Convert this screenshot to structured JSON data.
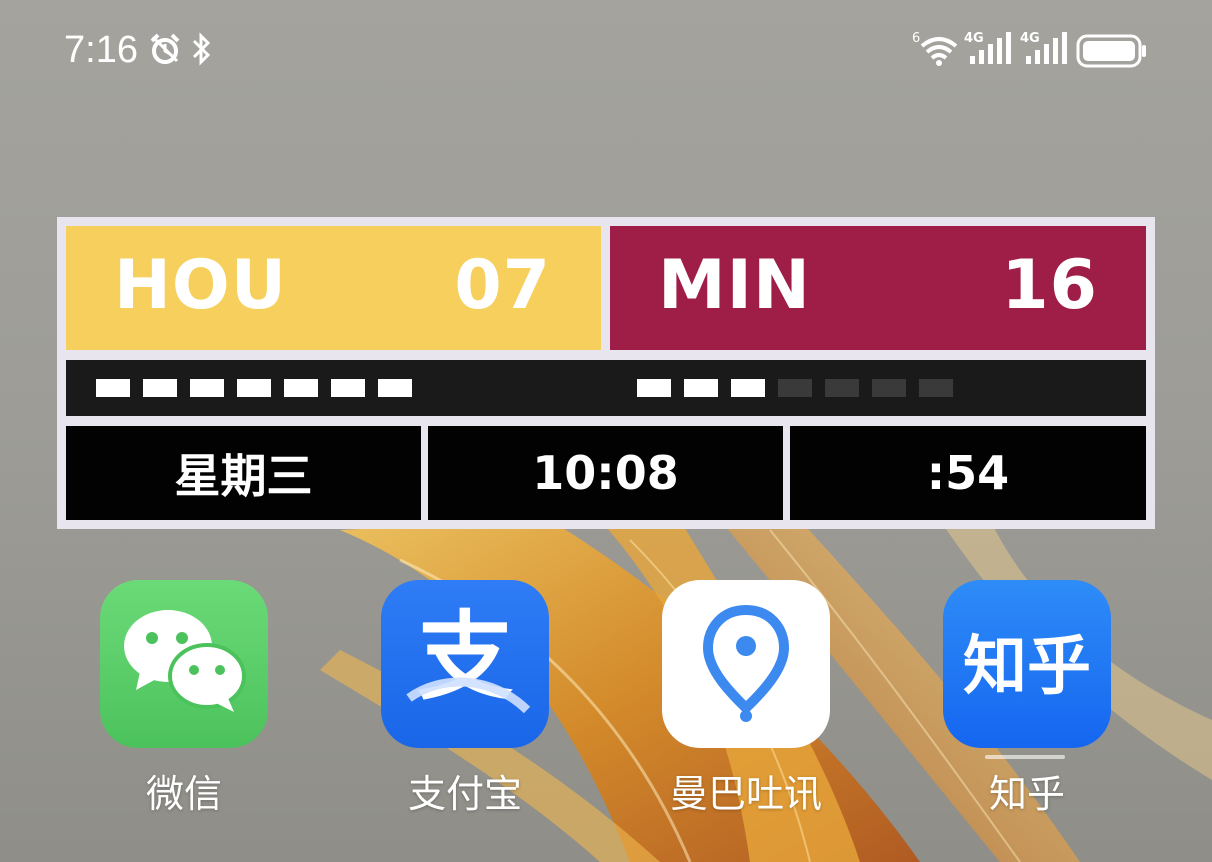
{
  "status_bar": {
    "time": "7:16",
    "icons": [
      "alarm-icon",
      "bluetooth-icon",
      "wifi-6-icon",
      "signal-4g-icon",
      "signal-4g-icon",
      "battery-icon"
    ],
    "wifi_label": "6",
    "net_label_1": "4G",
    "net_label_2": "4G"
  },
  "widget": {
    "home": {
      "name": "HOU",
      "score": "07",
      "color": "#f6cf5c"
    },
    "away": {
      "name": "MIN",
      "score": "16",
      "color": "#9f1e47"
    },
    "home_segments_on": 7,
    "away_segments_on": 3,
    "away_segments_total": 7,
    "weekday": "星期三",
    "time": "10:08",
    "seconds": ":54"
  },
  "apps": [
    {
      "label": "微信",
      "icon": "wechat-icon"
    },
    {
      "label": "支付宝",
      "icon": "alipay-icon",
      "glyph": "支"
    },
    {
      "label": "曼巴吐讯",
      "icon": "location-pin-icon"
    },
    {
      "label": "知乎",
      "icon": "zhihu-icon",
      "glyph": "知乎"
    }
  ]
}
